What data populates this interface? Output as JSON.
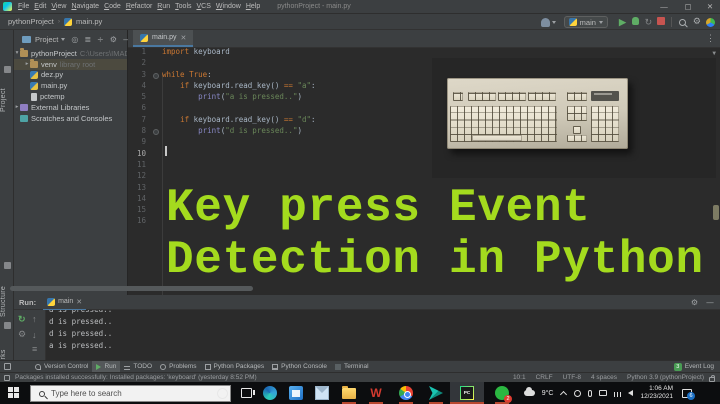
{
  "titlebar": {
    "menus": [
      "File",
      "Edit",
      "View",
      "Navigate",
      "Code",
      "Refactor",
      "Run",
      "Tools",
      "VCS",
      "Window",
      "Help"
    ],
    "title": "pythonProject - main.py",
    "window_buttons": [
      "—",
      "▢",
      "✕"
    ]
  },
  "breadcrumb": {
    "project": "pythonProject",
    "file": "main.py",
    "separator": "›"
  },
  "toolbar": {
    "run_config": "main"
  },
  "left_stripe": {
    "project": "Project",
    "structure": "Structure",
    "bookmarks": "Bookmarks"
  },
  "project_panel": {
    "title": "Project",
    "tree": [
      {
        "chevron": "▾",
        "icon": "folder",
        "label": "pythonProject",
        "suffix": "C:\\Users\\IMAD\\Py",
        "level": 0,
        "selected": false
      },
      {
        "chevron": "▸",
        "icon": "folder",
        "label": "venv",
        "suffix": "library root",
        "level": 1,
        "selected": true
      },
      {
        "chevron": "",
        "icon": "python-file",
        "label": "dez.py",
        "suffix": "",
        "level": 1,
        "selected": false
      },
      {
        "chevron": "",
        "icon": "python-file",
        "label": "main.py",
        "suffix": "",
        "level": 1,
        "selected": false
      },
      {
        "chevron": "",
        "icon": "text-file",
        "label": "pctemp",
        "suffix": "",
        "level": 1,
        "selected": false
      },
      {
        "chevron": "▸",
        "icon": "libraries",
        "label": "External Libraries",
        "suffix": "",
        "level": 0,
        "selected": false
      },
      {
        "chevron": "",
        "icon": "scratches",
        "label": "Scratches and Consoles",
        "suffix": "",
        "level": 0,
        "selected": false
      }
    ]
  },
  "editor": {
    "tab": "main.py",
    "line_count": 16,
    "current_line": 10,
    "lines": [
      [
        [
          "k",
          "import"
        ],
        [
          "d",
          " keyboard"
        ]
      ],
      [],
      [
        [
          "k",
          "while"
        ],
        [
          "d",
          " "
        ],
        [
          "k",
          "True"
        ],
        [
          "d",
          ":"
        ]
      ],
      [
        [
          "d",
          "    "
        ],
        [
          "k",
          "if"
        ],
        [
          "d",
          " keyboard.read_key() "
        ],
        [
          "o",
          "=="
        ],
        [
          "d",
          " "
        ],
        [
          "s",
          "\"a\""
        ],
        [
          "d",
          ":"
        ]
      ],
      [
        [
          "d",
          "        "
        ],
        [
          "f",
          "print"
        ],
        [
          "d",
          "("
        ],
        [
          "s",
          "\"a is pressed..\""
        ],
        [
          "d",
          ")"
        ]
      ],
      [],
      [
        [
          "d",
          "    "
        ],
        [
          "k",
          "if"
        ],
        [
          "d",
          " keyboard.read_key() "
        ],
        [
          "o",
          "=="
        ],
        [
          "d",
          " "
        ],
        [
          "s",
          "\"d\""
        ],
        [
          "d",
          ":"
        ]
      ],
      [
        [
          "d",
          "        "
        ],
        [
          "f",
          "print"
        ],
        [
          "d",
          "("
        ],
        [
          "s",
          "\"d is pressed..\""
        ],
        [
          "d",
          ")"
        ]
      ],
      [],
      [],
      [],
      [],
      [],
      [],
      [],
      []
    ]
  },
  "overlay": {
    "title_line1": "Key press Event",
    "title_line2": "Detection in Python",
    "title_color": "#a4db1e",
    "illustration": "beige-keyboard-photo"
  },
  "run_panel": {
    "label": "Run:",
    "tab": "main",
    "console": [
      "a is pressed..",
      "d is pressed..",
      "d is pressed..",
      "a is pressed.."
    ]
  },
  "tool_windows": {
    "items": [
      {
        "icon": "version-control",
        "label": "Version Control",
        "active": false
      },
      {
        "icon": "run",
        "label": "Run",
        "active": true
      },
      {
        "icon": "todo",
        "label": "TODO",
        "active": false
      },
      {
        "icon": "problems",
        "label": "Problems",
        "active": false
      },
      {
        "icon": "packages",
        "label": "Python Packages",
        "active": false
      },
      {
        "icon": "python-console",
        "label": "Python Console",
        "active": false
      },
      {
        "icon": "terminal",
        "label": "Terminal",
        "active": false
      }
    ],
    "event_log": {
      "badge": "3",
      "label": "Event Log"
    }
  },
  "status_bar": {
    "message": "Packages installed successfully: Installed packages: 'keyboard' (yesterday 8:52 PM)",
    "right": [
      "10:1",
      "CRLF",
      "UTF-8",
      "4 spaces",
      "Python 3.9 (pythonProject)"
    ]
  },
  "taskbar": {
    "search_placeholder": "Type here to search",
    "tray": {
      "temperature": "9°C",
      "time": "1:06 AM",
      "date": "12/23/2021",
      "notification_badge": "6",
      "whatsapp_badge": "2"
    }
  }
}
